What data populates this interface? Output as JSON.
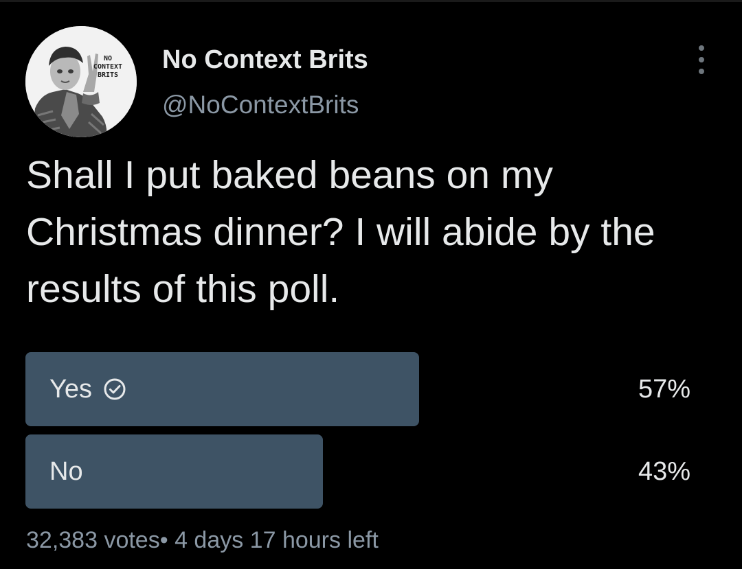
{
  "author": {
    "display_name": "No Context Brits",
    "handle": "@NoContextBrits",
    "avatar_icon": "profile-photo-boy-v-sign",
    "avatar_logo_text": "NO CONTEXT BRITS"
  },
  "more_icon": "more-options-vertical-dots-icon",
  "tweet": {
    "text": "Shall I put baked beans on my Christmas dinner? I will abide by the results of this poll."
  },
  "poll": {
    "bar_color": "#3e5365",
    "options": [
      {
        "label": "Yes",
        "percent_text": "57%",
        "share": 0.57,
        "selected": true,
        "icon": "check-circle-icon"
      },
      {
        "label": "No",
        "percent_text": "43%",
        "share": 0.43,
        "selected": false
      }
    ],
    "votes_text": "32,383 votes",
    "separator": "•",
    "time_left_text": "4 days 17 hours left"
  },
  "colors": {
    "background": "#000000",
    "primary_text": "#e7e9ea",
    "secondary_text": "#8b98a5"
  }
}
